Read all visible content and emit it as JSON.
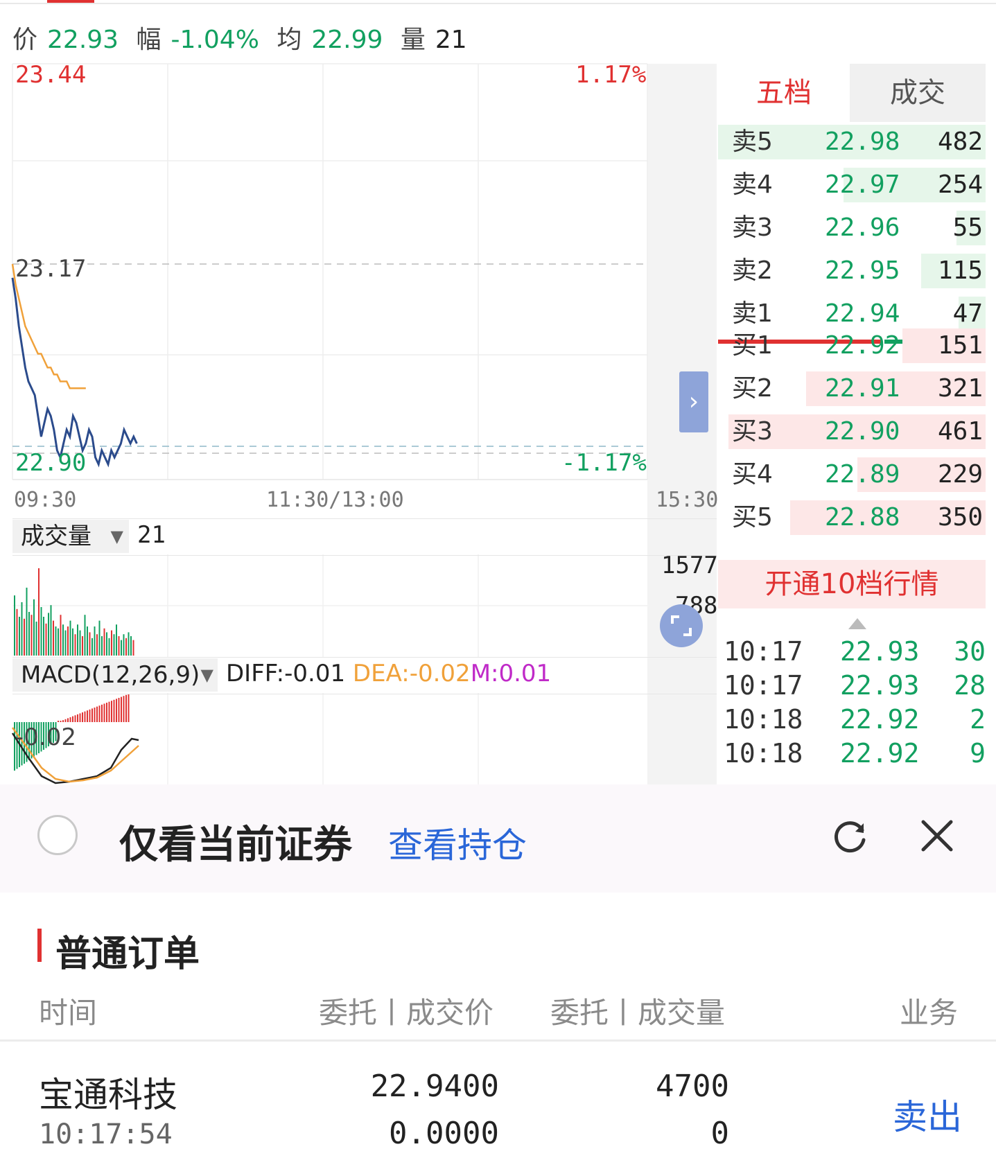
{
  "quote": {
    "price_label": "价",
    "price": "22.93",
    "change_label": "幅",
    "change": "-1.04%",
    "avg_label": "均",
    "avg": "22.99",
    "volume_label": "量",
    "volume": "21"
  },
  "intraday": {
    "y_high": "23.44",
    "y_mid": "23.17",
    "y_low": "22.90",
    "pct_high": "1.17%",
    "pct_low": "-1.17%",
    "t_start": "09:30",
    "t_mid": "11:30/13:00",
    "t_end": "15:30",
    "price_line": [
      23.15,
      23.12,
      23.08,
      23.05,
      23.02,
      23.0,
      22.99,
      22.98,
      22.95,
      22.92,
      22.94,
      22.96,
      22.95,
      22.93,
      22.9,
      22.89,
      22.91,
      22.93,
      22.92,
      22.95,
      22.94,
      22.92,
      22.9,
      22.91,
      22.93,
      22.92,
      22.89,
      22.88,
      22.9,
      22.89,
      22.88,
      22.9,
      22.89,
      22.9,
      22.91,
      22.93,
      22.92,
      22.91,
      22.92,
      22.91
    ],
    "avg_line": [
      23.17,
      23.14,
      23.12,
      23.1,
      23.08,
      23.07,
      23.06,
      23.05,
      23.04,
      23.04,
      23.03,
      23.02,
      23.02,
      23.01,
      23.01,
      23.0,
      23.0,
      23.0,
      22.99,
      22.99,
      22.99,
      22.99,
      22.99,
      22.99
    ],
    "colors": {
      "price": "#2b4b8c",
      "avg": "#f0a13a",
      "rise": "#e03131",
      "fall": "#12a060"
    }
  },
  "volume_panel": {
    "selector_label": "成交量",
    "current": "21",
    "y_top": "1577",
    "y_mid": "788",
    "bars": [
      0.62,
      0.48,
      0.4,
      0.55,
      0.38,
      0.7,
      0.45,
      0.42,
      0.58,
      0.35,
      0.9,
      0.5,
      0.4,
      0.33,
      0.44,
      0.52,
      0.36,
      0.3,
      0.28,
      0.42,
      0.32,
      0.26,
      0.3,
      0.36,
      0.28,
      0.22,
      0.32,
      0.26,
      0.2,
      0.42,
      0.3,
      0.24,
      0.18,
      0.3,
      0.22,
      0.36,
      0.2,
      0.28,
      0.24,
      0.18,
      0.26,
      0.22,
      0.32,
      0.2,
      0.16,
      0.22,
      0.18,
      0.24,
      0.2,
      0.16
    ]
  },
  "macd_panel": {
    "selector_label": "MACD(12,26,9)",
    "diff": "DIFF:-0.01",
    "dea": "DEA:-0.02",
    "m": "M:0.01",
    "axis_label": "-0.02"
  },
  "order_book": {
    "tab_active": "五档",
    "tab_other": "成交",
    "asks": [
      {
        "label": "卖5",
        "price": "22.98",
        "volume": "482",
        "weight": 1.0
      },
      {
        "label": "卖4",
        "price": "22.97",
        "volume": "254",
        "weight": 0.53
      },
      {
        "label": "卖3",
        "price": "22.96",
        "volume": "55",
        "weight": 0.11
      },
      {
        "label": "卖2",
        "price": "22.95",
        "volume": "115",
        "weight": 0.24
      },
      {
        "label": "卖1",
        "price": "22.94",
        "volume": "47",
        "weight": 0.1
      }
    ],
    "bids": [
      {
        "label": "买1",
        "price": "22.92",
        "volume": "151",
        "weight": 0.31
      },
      {
        "label": "买2",
        "price": "22.91",
        "volume": "321",
        "weight": 0.67
      },
      {
        "label": "买3",
        "price": "22.90",
        "volume": "461",
        "weight": 0.96
      },
      {
        "label": "买4",
        "price": "22.89",
        "volume": "229",
        "weight": 0.48
      },
      {
        "label": "买5",
        "price": "22.88",
        "volume": "350",
        "weight": 0.73
      }
    ],
    "upgrade_label": "开通10档行情",
    "trades": [
      {
        "time": "10:17",
        "price": "22.93",
        "volume": "30"
      },
      {
        "time": "10:17",
        "price": "22.93",
        "volume": "28"
      },
      {
        "time": "10:18",
        "price": "22.92",
        "volume": "2"
      },
      {
        "time": "10:18",
        "price": "22.92",
        "volume": "9"
      }
    ]
  },
  "filter": {
    "only_current_label": "仅看当前证券",
    "view_positions_label": "查看持仓"
  },
  "orders": {
    "section_title": "普通订单",
    "columns": [
      "时间",
      "委托丨成交价",
      "委托丨成交量",
      "业务"
    ],
    "rows": [
      {
        "name": "宝通科技",
        "time": "10:17:54",
        "order_price": "22.9400",
        "deal_price": "0.0000",
        "order_qty": "4700",
        "deal_qty": "0",
        "action": "卖出"
      }
    ]
  }
}
